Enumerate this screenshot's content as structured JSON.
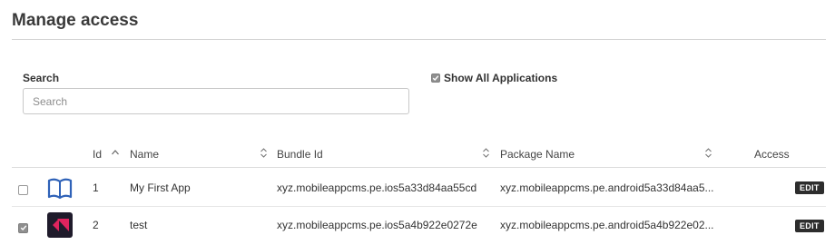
{
  "page": {
    "title": "Manage access"
  },
  "search": {
    "label": "Search",
    "placeholder": "Search",
    "value": ""
  },
  "filters": {
    "show_all_label": "Show All Applications",
    "show_all_checked": true
  },
  "table": {
    "columns": {
      "id": "Id",
      "name": "Name",
      "bundle_id": "Bundle Id",
      "package_name": "Package Name",
      "access": "Access"
    },
    "rows": [
      {
        "checked": false,
        "icon": "book-icon",
        "id": "1",
        "name": "My First App",
        "bundle_id": "xyz.mobileappcms.pe.ios5a33d84aa55cd",
        "package_name": "xyz.mobileappcms.pe.android5a33d84aa5...",
        "action": "EDIT"
      },
      {
        "checked": true,
        "icon": "app-logo-icon",
        "id": "2",
        "name": "test",
        "bundle_id": "xyz.mobileappcms.pe.ios5a4b922e0272e",
        "package_name": "xyz.mobileappcms.pe.android5a4b922e02...",
        "action": "EDIT"
      }
    ]
  },
  "colors": {
    "edit_button": "#2d2d2d",
    "book_icon": "#2f62b8",
    "logo_bg": "#1f1b2b",
    "logo_accent": "#e0245e"
  }
}
